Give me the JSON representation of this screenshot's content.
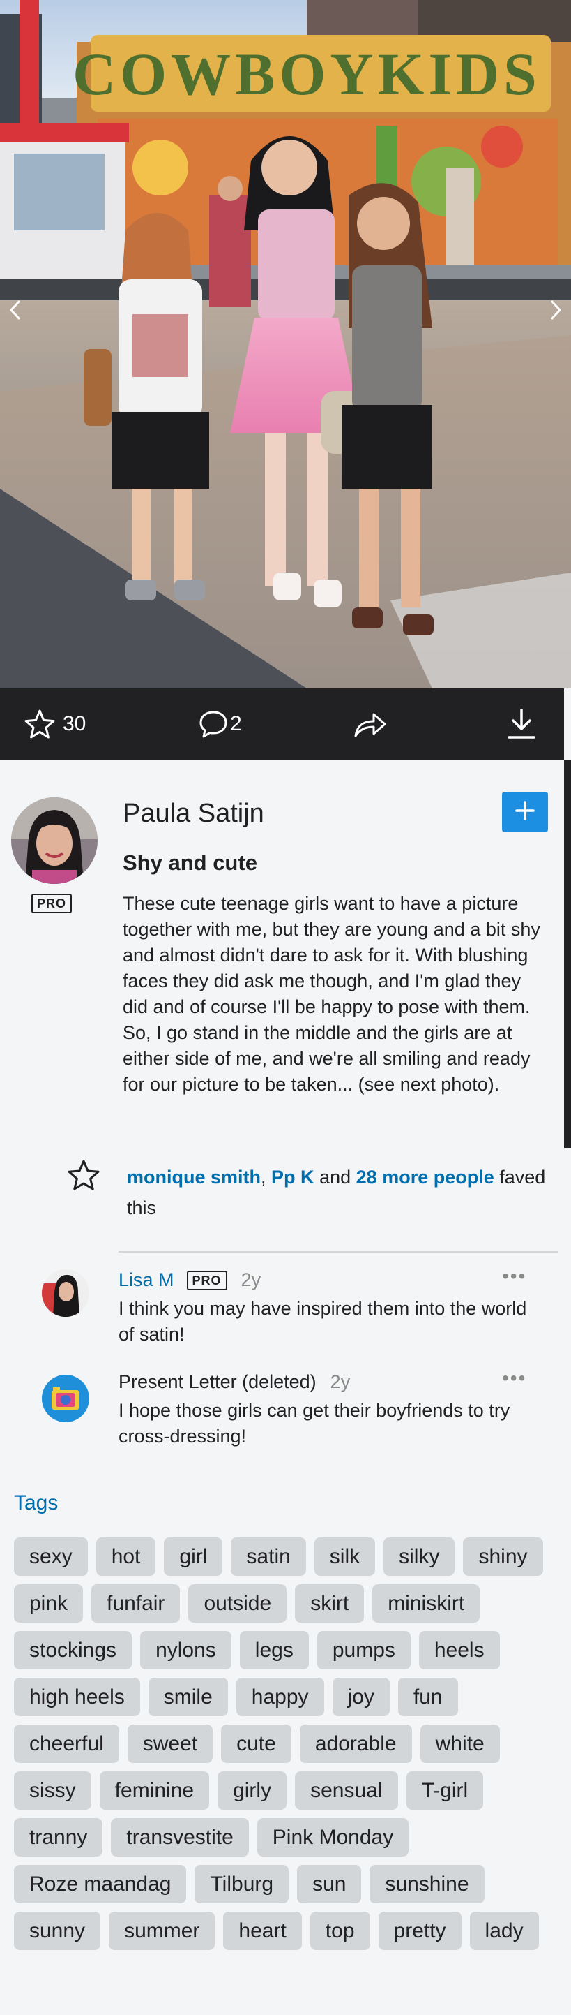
{
  "photo": {
    "sign_text": "COWBOYKIDS",
    "alt": "",
    "prev_icon": "chevron-left-icon",
    "next_icon": "chevron-right-icon"
  },
  "actions": {
    "fav_icon": "star-icon",
    "fav_count": "30",
    "comment_icon": "comment-icon",
    "comment_count": "2",
    "share_icon": "share-icon",
    "download_icon": "download-icon"
  },
  "owner": {
    "name": "Paula Satijn",
    "pro_label": "PRO",
    "follow_icon": "plus-icon",
    "title": "Shy and cute",
    "description": "These cute teenage girls want to have a picture together with me, but they are young and a bit shy and almost didn't dare to ask for it. With blushing faces they did ask me though, and I'm glad they did and of course I'll be happy to pose with them. So, I go stand in the middle and the girls are at either side of me, and we're all smiling and ready for our picture to be taken... (see next photo)."
  },
  "faves": {
    "person1": "monique smith",
    "sep1": ",",
    "person2": "Pp K",
    "and_text": "and",
    "more_people": "28 more people",
    "suffix": "faved this"
  },
  "comments": [
    {
      "author": "Lisa M",
      "pro_label": "PRO",
      "time": "2y",
      "more": "•••",
      "text": "I think you may have inspired them into the world of satin!"
    },
    {
      "author": "Present Letter (deleted)",
      "time": "2y",
      "more": "•••",
      "text": "I hope those girls can get their boyfriends to try cross-dressing!"
    }
  ],
  "tags_title": "Tags",
  "tags": [
    "sexy",
    "hot",
    "girl",
    "satin",
    "silk",
    "silky",
    "shiny",
    "pink",
    "funfair",
    "outside",
    "skirt",
    "miniskirt",
    "stockings",
    "nylons",
    "legs",
    "pumps",
    "heels",
    "high heels",
    "smile",
    "happy",
    "joy",
    "fun",
    "cheerful",
    "sweet",
    "cute",
    "adorable",
    "white",
    "sissy",
    "feminine",
    "girly",
    "sensual",
    "T-girl",
    "tranny",
    "transvestite",
    "Pink Monday",
    "Roze maandag",
    "Tilburg",
    "sun",
    "sunshine",
    "sunny",
    "summer",
    "heart",
    "top",
    "pretty",
    "lady"
  ],
  "colors": {
    "link": "#006dac",
    "follow_button": "#1c8fe3",
    "action_bar": "#212124",
    "tag_bg": "#d3d6d9",
    "page_bg": "#f3f5f6"
  }
}
